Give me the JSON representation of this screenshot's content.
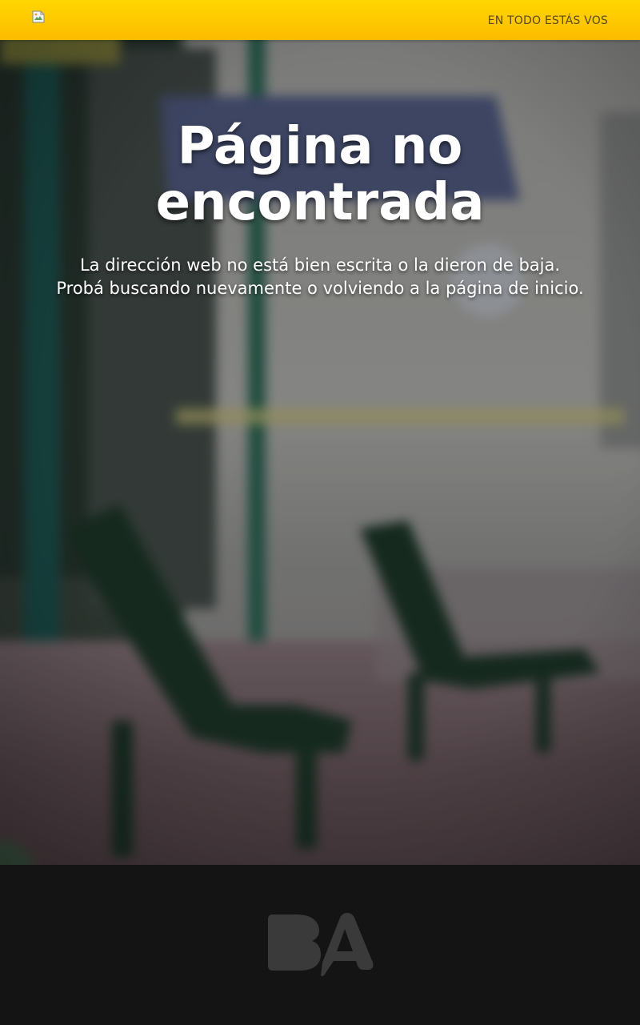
{
  "header": {
    "logo": {
      "icon": "broken-image-icon"
    },
    "tagline": "EN TODO ESTÁS VOS",
    "background_color": "#FFCC00"
  },
  "hero": {
    "title_line1": "Página no",
    "title_line2": "encontrada",
    "message_line1": "La dirección web no está bien escrita o la dieron de baja.",
    "message_line2": "Probá buscando nuevamente o volviendo a la página de inicio.",
    "background": "blurred-park-benches-photo"
  },
  "footer": {
    "logo": {
      "icon": "ba-logo-icon",
      "color": "#3A3A3A"
    },
    "background_color": "#141414"
  }
}
